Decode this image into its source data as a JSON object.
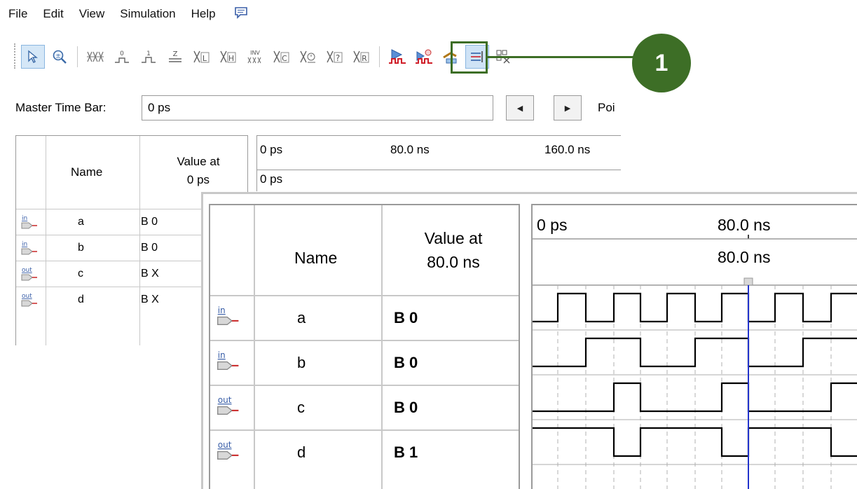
{
  "menu": [
    "File",
    "Edit",
    "View",
    "Simulation",
    "Help"
  ],
  "toolbar": {
    "tools": [
      {
        "name": "pointer-tool",
        "glyph": "↖",
        "active": true
      },
      {
        "name": "zoom-tool",
        "glyph": "⊕"
      },
      {
        "name": "forcing-unknown-tool",
        "glyph": "⁂"
      },
      {
        "name": "forcing-low-tool",
        "glyph": "0"
      },
      {
        "name": "forcing-high-tool",
        "glyph": "1"
      },
      {
        "name": "high-impedance-tool",
        "glyph": "Z"
      },
      {
        "name": "weak-low-tool",
        "glyph": "L"
      },
      {
        "name": "weak-high-tool",
        "glyph": "H"
      },
      {
        "name": "invert-tool",
        "glyph": "INV"
      },
      {
        "name": "count-value-tool",
        "glyph": "C"
      },
      {
        "name": "clock-tool",
        "glyph": "⏱"
      },
      {
        "name": "arbitrary-value-tool",
        "glyph": "?"
      },
      {
        "name": "random-value-tool",
        "glyph": "R"
      },
      {
        "name": "run-functional-simulation-tool",
        "glyph": "▶",
        "highlighted": true
      },
      {
        "name": "run-timing-simulation-tool",
        "glyph": "▶"
      },
      {
        "name": "generate-netlist-tool",
        "glyph": "↗"
      },
      {
        "name": "snap-to-grid-tool",
        "glyph": "⇉",
        "toggled": true
      },
      {
        "name": "grid-tool",
        "glyph": "⚏"
      }
    ],
    "callout_number": "1"
  },
  "master_time_bar": {
    "label": "Master Time Bar:",
    "value": "0 ps",
    "prev_label": "◀",
    "next_label": "▶",
    "pointer_label": "Poi"
  },
  "background_table": {
    "header_name": "Name",
    "header_value_line1": "Value at",
    "header_value_line2": "0 ps",
    "rows": [
      {
        "dir": "in",
        "name": "a",
        "value": "B 0"
      },
      {
        "dir": "in",
        "name": "b",
        "value": "B 0"
      },
      {
        "dir": "out",
        "name": "c",
        "value": "B X"
      },
      {
        "dir": "out",
        "name": "d",
        "value": "B X"
      }
    ]
  },
  "background_timeline": {
    "ticks": [
      "0 ps",
      "80.0 ns",
      "160.0 ns"
    ],
    "cursor_label": "0 ps"
  },
  "zoom_table": {
    "header_name": "Name",
    "header_value_line1": "Value at",
    "header_value_line2": "80.0 ns",
    "rows": [
      {
        "dir": "in",
        "name": "a",
        "value": "B 0"
      },
      {
        "dir": "in",
        "name": "b",
        "value": "B 0"
      },
      {
        "dir": "out",
        "name": "c",
        "value": "B 0"
      },
      {
        "dir": "out",
        "name": "d",
        "value": "B 1"
      }
    ]
  },
  "zoom_timeline": {
    "ticks": [
      "0 ps",
      "80.0 ns"
    ],
    "cursor_label": "80.0 ns"
  },
  "colors": {
    "callout_green": "#3d6e26",
    "cursor_blue": "#2233cc",
    "selection_blue": "#d5e7f7"
  }
}
